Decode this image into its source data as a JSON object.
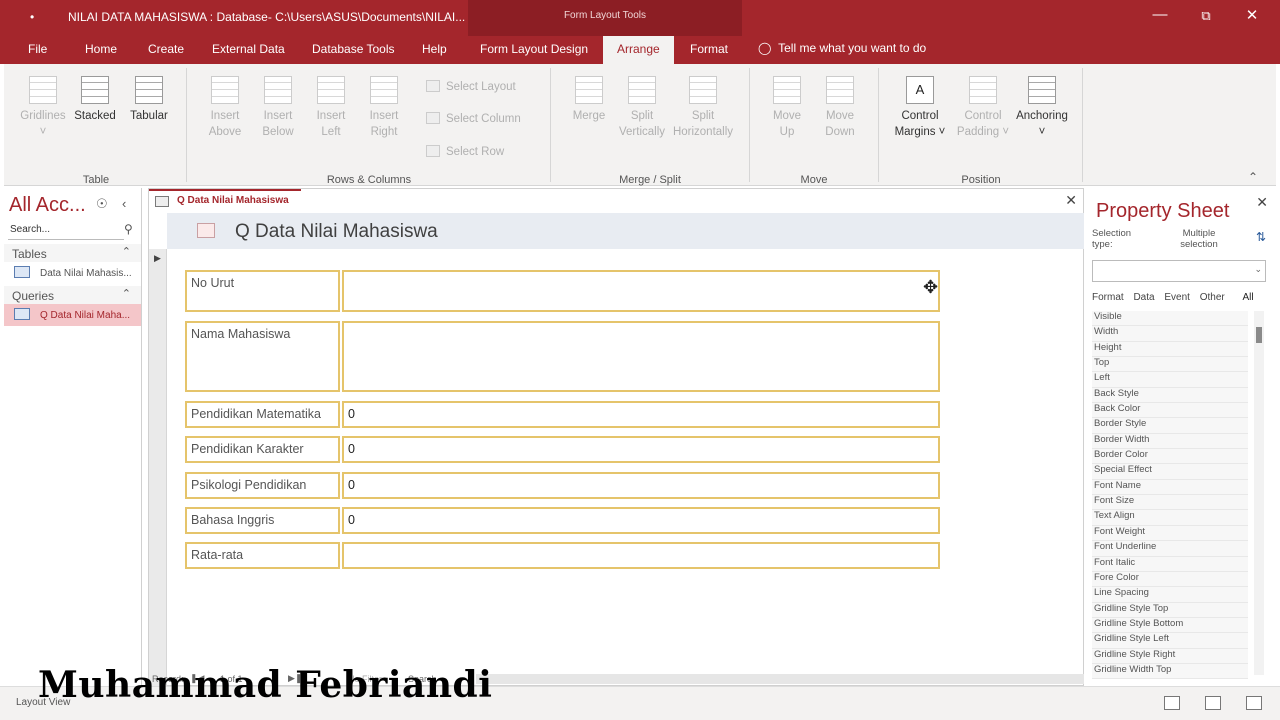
{
  "titlebar": {
    "quick_access": "•",
    "title": "NILAI DATA MAHASISWA : Database- C:\\Users\\ASUS\\Documents\\NILAI...",
    "context_title": "Form Layout Tools",
    "minimize": "—",
    "restore": "⧉",
    "close": "✕"
  },
  "tabs": [
    "File",
    "Home",
    "Create",
    "External Data",
    "Database Tools",
    "Help",
    "Form Layout Design",
    "Arrange",
    "Format"
  ],
  "tell_me": "Tell me what you want to do",
  "ribbon": {
    "table": {
      "gridlines": "Gridlines",
      "stacked": "Stacked",
      "tabular": "Tabular",
      "label": "Table"
    },
    "rows_columns": {
      "insert_above": "Insert Above",
      "insert_below": "Insert Below",
      "insert_left": "Insert Left",
      "insert_right": "Insert Right",
      "select_layout": "Select Layout",
      "select_column": "Select Column",
      "select_row": "Select Row",
      "label": "Rows & Columns"
    },
    "merge_split": {
      "merge": "Merge",
      "split_vertically": "Split Vertically",
      "split_horizontally": "Split Horizontally",
      "label": "Merge / Split"
    },
    "move": {
      "move_up": "Move Up",
      "move_down": "Move Down",
      "label": "Move"
    },
    "position": {
      "control_margins": "Control Margins",
      "control_padding": "Control Padding",
      "anchoring": "Anchoring",
      "label": "Position"
    }
  },
  "nav": {
    "title": "All Acc...",
    "search_placeholder": "Search...",
    "tables_header": "Tables",
    "table_item": "Data Nilai Mahasis...",
    "queries_header": "Queries",
    "query_item": "Q Data Nilai Maha..."
  },
  "document": {
    "tab_label": "Q Data Nilai Mahasiswa",
    "form_title": "Q Data Nilai Mahasiswa",
    "fields": [
      {
        "label": "No Urut",
        "value": ""
      },
      {
        "label": "Nama Mahasiswa",
        "value": ""
      },
      {
        "label": "Pendidikan Matematika",
        "value": "0"
      },
      {
        "label": "Pendidikan Karakter",
        "value": "0"
      },
      {
        "label": "Psikologi Pendidikan",
        "value": "0"
      },
      {
        "label": "Bahasa Inggris",
        "value": "0"
      },
      {
        "label": "Rata-rata",
        "value": ""
      }
    ],
    "record_label": "Record:",
    "record_position": "1 of 1",
    "filter_label": "No Filter",
    "search_label": "Search"
  },
  "property_sheet": {
    "title": "Property Sheet",
    "selection_type_label": "Selection type:",
    "selection_type_value": "Multiple selection",
    "tabs": [
      "Format",
      "Data",
      "Event",
      "Other",
      "All"
    ],
    "active_tab": "All",
    "properties": [
      "Visible",
      "Width",
      "Height",
      "Top",
      "Left",
      "Back Style",
      "Back Color",
      "Border Style",
      "Border Width",
      "Border Color",
      "Special Effect",
      "Font Name",
      "Font Size",
      "Text Align",
      "Font Weight",
      "Font Underline",
      "Font Italic",
      "Fore Color",
      "Line Spacing",
      "Gridline Style Top",
      "Gridline Style Bottom",
      "Gridline Style Left",
      "Gridline Style Right",
      "Gridline Width Top"
    ]
  },
  "status": {
    "text": "Layout View"
  },
  "watermark": "Muhammad Febriandi",
  "colors": {
    "accent": "#a4262c",
    "field_border": "#e5c46b"
  }
}
